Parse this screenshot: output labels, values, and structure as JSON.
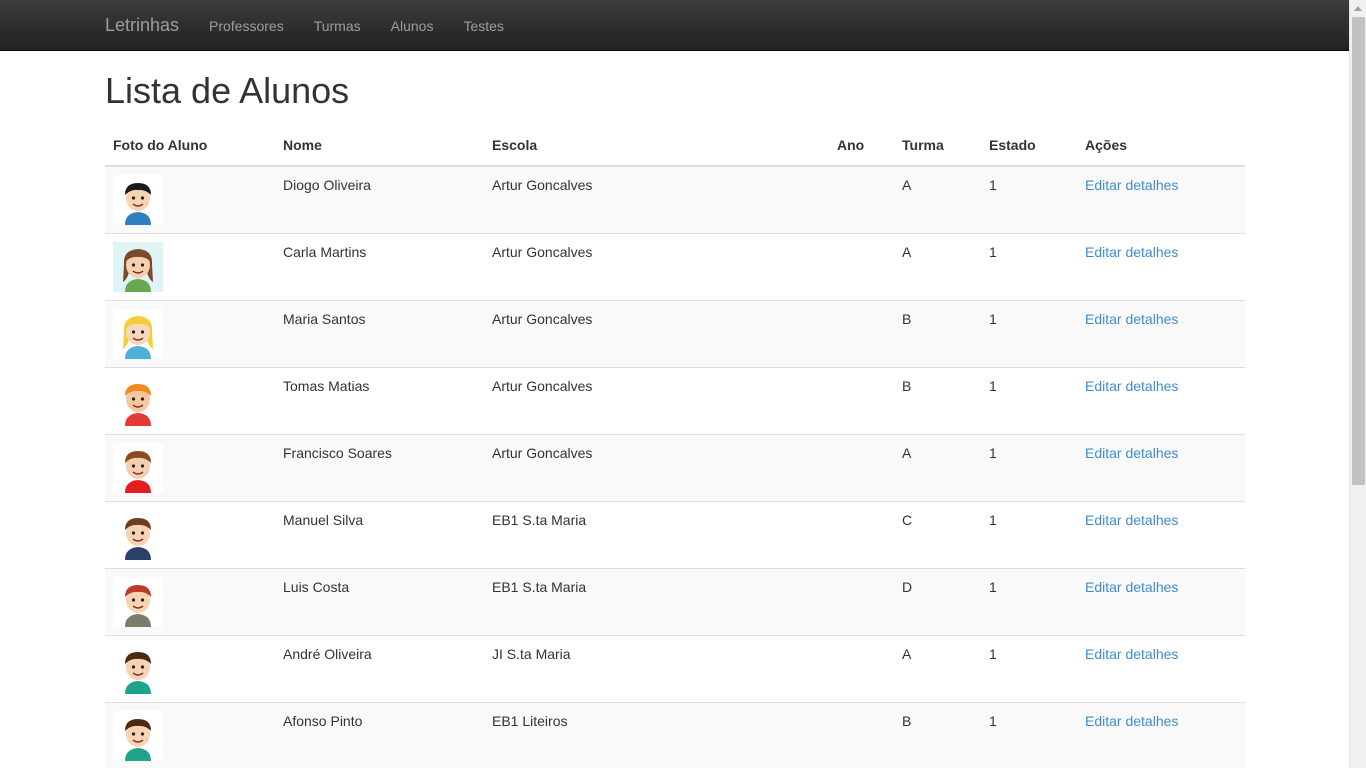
{
  "navbar": {
    "brand": "Letrinhas",
    "items": [
      "Professores",
      "Turmas",
      "Alunos",
      "Testes"
    ]
  },
  "page": {
    "title": "Lista de Alunos"
  },
  "table": {
    "headers": [
      "Foto do Aluno",
      "Nome",
      "Escola",
      "Ano",
      "Turma",
      "Estado",
      "Ações"
    ],
    "rows": [
      {
        "nome": "Diogo Oliveira",
        "escola": "Artur Goncalves",
        "ano": "",
        "turma": "A",
        "estado": "1",
        "acao": "Editar detalhes",
        "avatar": "boy-dark-hair-blue-shirt"
      },
      {
        "nome": "Carla Martins",
        "escola": "Artur Goncalves",
        "ano": "",
        "turma": "A",
        "estado": "1",
        "acao": "Editar detalhes",
        "avatar": "girl-brown-hair-green"
      },
      {
        "nome": "Maria Santos",
        "escola": "Artur Goncalves",
        "ano": "",
        "turma": "B",
        "estado": "1",
        "acao": "Editar detalhes",
        "avatar": "girl-blonde-hair"
      },
      {
        "nome": "Tomas Matias",
        "escola": "Artur Goncalves",
        "ano": "",
        "turma": "B",
        "estado": "1",
        "acao": "Editar detalhes",
        "avatar": "boy-orange-hair-red"
      },
      {
        "nome": "Francisco Soares",
        "escola": "Artur Goncalves",
        "ano": "",
        "turma": "A",
        "estado": "1",
        "acao": "Editar detalhes",
        "avatar": "boy-brown-hair-red-shirt"
      },
      {
        "nome": "Manuel Silva",
        "escola": "EB1 S.ta Maria",
        "ano": "",
        "turma": "C",
        "estado": "1",
        "acao": "Editar detalhes",
        "avatar": "boy-brown-hair-suit"
      },
      {
        "nome": "Luis Costa",
        "escola": "EB1 S.ta Maria",
        "ano": "",
        "turma": "D",
        "estado": "1",
        "acao": "Editar detalhes",
        "avatar": "boy-red-hair-plaid"
      },
      {
        "nome": "André Oliveira",
        "escola": "JI S.ta Maria",
        "ano": "",
        "turma": "A",
        "estado": "1",
        "acao": "Editar detalhes",
        "avatar": "boy-dark-hair-teal"
      },
      {
        "nome": "Afonso Pinto",
        "escola": "EB1 Liteiros",
        "ano": "",
        "turma": "B",
        "estado": "1",
        "acao": "Editar detalhes",
        "avatar": "boy-dark-hair-teal"
      }
    ]
  },
  "colors": {
    "navbar": "#222222",
    "link": "#428bca",
    "striped_row": "#f9f9f9"
  }
}
